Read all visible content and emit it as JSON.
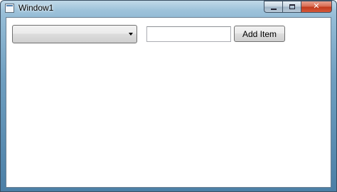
{
  "window": {
    "title": "Window1",
    "caption_buttons": {
      "minimize": "minimize",
      "maximize": "maximize",
      "close": "✕"
    }
  },
  "form": {
    "combo": {
      "selected_value": ""
    },
    "item_input": {
      "value": ""
    },
    "add_button_label": "Add Item"
  },
  "colors": {
    "client_background": "#ffffff",
    "close_button": "#c0391b"
  }
}
